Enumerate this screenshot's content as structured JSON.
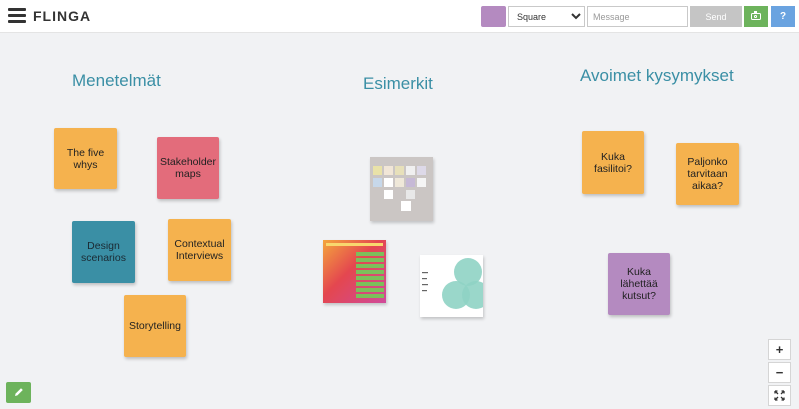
{
  "app": {
    "logo": "FLINGA"
  },
  "toolbar": {
    "color": "#b48ac0",
    "shape_selected": "Square",
    "message_placeholder": "Message",
    "send_label": "Send",
    "help_label": "?"
  },
  "columns": [
    {
      "title": "Menetelmät"
    },
    {
      "title": "Esimerkit"
    },
    {
      "title": "Avoimet kysymykset"
    }
  ],
  "notes": [
    {
      "text": "The five whys",
      "color": "#f5b24e"
    },
    {
      "text": "Stakeholder maps",
      "color": "#e36c7b"
    },
    {
      "text": "Design scenarios",
      "color": "#3a8fa5"
    },
    {
      "text": "Contextual Interviews",
      "color": "#f5b24e"
    },
    {
      "text": "Storytelling",
      "color": "#f5b24e"
    },
    {
      "text": "Kuka fasilitoi?",
      "color": "#f5b24e"
    },
    {
      "text": "Paljonko tarvitaan aikaa?",
      "color": "#f5b24e"
    },
    {
      "text": "Kuka lähettää kutsut?",
      "color": "#b48ac0"
    }
  ],
  "zoom": {
    "in_label": "+",
    "out_label": "−"
  },
  "icons": [
    "hamburger-menu-icon",
    "camera-icon",
    "pencil-icon",
    "fit-screen-icon"
  ]
}
